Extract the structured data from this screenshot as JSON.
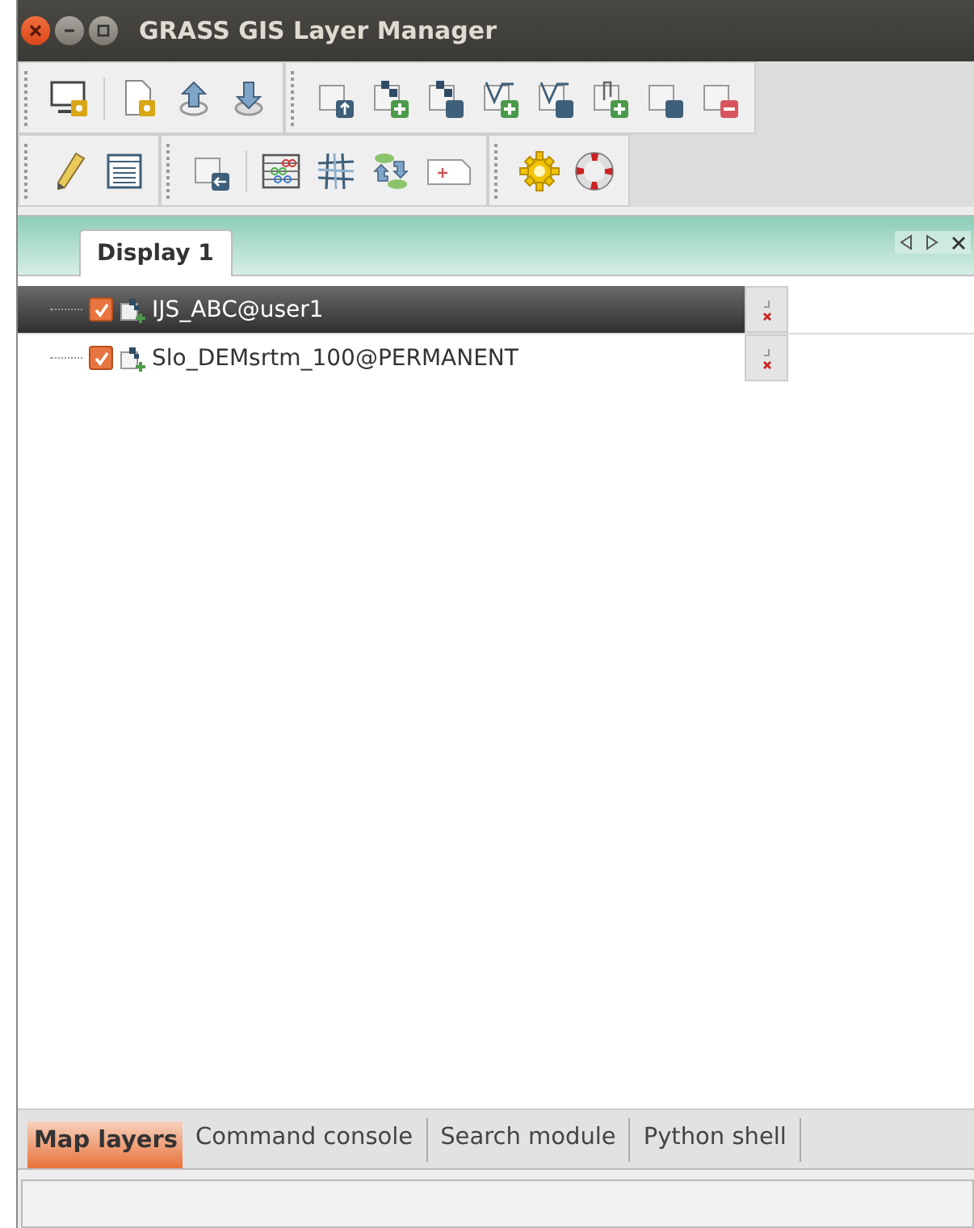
{
  "window": {
    "title": "GRASS GIS Layer Manager"
  },
  "display_tabs": [
    {
      "label": "Display 1",
      "selected": true
    }
  ],
  "layers": [
    {
      "name": "IJS_ABC@user1",
      "checked": true,
      "selected": true,
      "kind": "raster"
    },
    {
      "name": "Slo_DEMsrtm_100@PERMANENT",
      "checked": true,
      "selected": false,
      "kind": "raster"
    }
  ],
  "bottom_tabs": [
    {
      "label": "Map layers",
      "selected": true
    },
    {
      "label": "Command console",
      "selected": false
    },
    {
      "label": "Search module",
      "selected": false
    },
    {
      "label": "Python shell",
      "selected": false
    }
  ]
}
